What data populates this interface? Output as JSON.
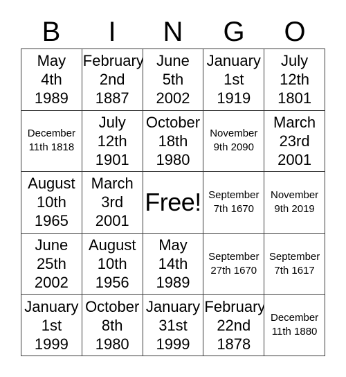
{
  "card": {
    "header_letters": [
      "B",
      "I",
      "N",
      "G",
      "O"
    ],
    "columns": 5,
    "rows": 5,
    "free_space_label": "Free!",
    "free_space_position": {
      "row": 3,
      "column": 3
    },
    "background_color": "#ffffff",
    "text_color": "#000000",
    "border_color": "#3a3a3a",
    "grid": [
      [
        {
          "text": "May\n4th\n1989",
          "month": "May",
          "day": "4th",
          "year": "1989",
          "size": "lg"
        },
        {
          "text": "February\n2nd\n1887",
          "month": "February",
          "day": "2nd",
          "year": "1887",
          "size": "lg"
        },
        {
          "text": "June\n5th\n2002",
          "month": "June",
          "day": "5th",
          "year": "2002",
          "size": "lg"
        },
        {
          "text": "January\n1st\n1919",
          "month": "January",
          "day": "1st",
          "year": "1919",
          "size": "lg"
        },
        {
          "text": "July\n12th\n1801",
          "month": "July",
          "day": "12th",
          "year": "1801",
          "size": "lg"
        }
      ],
      [
        {
          "text": "December\n11th 1818",
          "month": "December",
          "day": "11th",
          "year": "1818",
          "size": "sm"
        },
        {
          "text": "July\n12th\n1901",
          "month": "July",
          "day": "12th",
          "year": "1901",
          "size": "lg"
        },
        {
          "text": "October\n18th\n1980",
          "month": "October",
          "day": "18th",
          "year": "1980",
          "size": "lg"
        },
        {
          "text": "November\n9th 2090",
          "month": "November",
          "day": "9th",
          "year": "2090",
          "size": "sm"
        },
        {
          "text": "March\n23rd\n2001",
          "month": "March",
          "day": "23rd",
          "year": "2001",
          "size": "lg"
        }
      ],
      [
        {
          "text": "August\n10th\n1965",
          "month": "August",
          "day": "10th",
          "year": "1965",
          "size": "lg"
        },
        {
          "text": "March\n3rd\n2001",
          "month": "March",
          "day": "3rd",
          "year": "2001",
          "size": "lg"
        },
        {
          "text": "Free!",
          "month": "",
          "day": "",
          "year": "",
          "size": "free"
        },
        {
          "text": "September\n7th 1670",
          "month": "September",
          "day": "7th",
          "year": "1670",
          "size": "sm"
        },
        {
          "text": "November\n9th 2019",
          "month": "November",
          "day": "9th",
          "year": "2019",
          "size": "sm"
        }
      ],
      [
        {
          "text": "June\n25th\n2002",
          "month": "June",
          "day": "25th",
          "year": "2002",
          "size": "lg"
        },
        {
          "text": "August\n10th\n1956",
          "month": "August",
          "day": "10th",
          "year": "1956",
          "size": "lg"
        },
        {
          "text": "May\n14th\n1989",
          "month": "May",
          "day": "14th",
          "year": "1989",
          "size": "lg"
        },
        {
          "text": "September\n27th 1670",
          "month": "September",
          "day": "27th",
          "year": "1670",
          "size": "sm"
        },
        {
          "text": "September\n7th 1617",
          "month": "September",
          "day": "7th",
          "year": "1617",
          "size": "sm"
        }
      ],
      [
        {
          "text": "January\n1st\n1999",
          "month": "January",
          "day": "1st",
          "year": "1999",
          "size": "lg"
        },
        {
          "text": "October\n8th\n1980",
          "month": "October",
          "day": "8th",
          "year": "1980",
          "size": "lg"
        },
        {
          "text": "January\n31st\n1999",
          "month": "January",
          "day": "31st",
          "year": "1999",
          "size": "lg"
        },
        {
          "text": "February\n22nd\n1878",
          "month": "February",
          "day": "22nd",
          "year": "1878",
          "size": "lg"
        },
        {
          "text": "December\n11th 1880",
          "month": "December",
          "day": "11th",
          "year": "1880",
          "size": "sm"
        }
      ]
    ]
  }
}
